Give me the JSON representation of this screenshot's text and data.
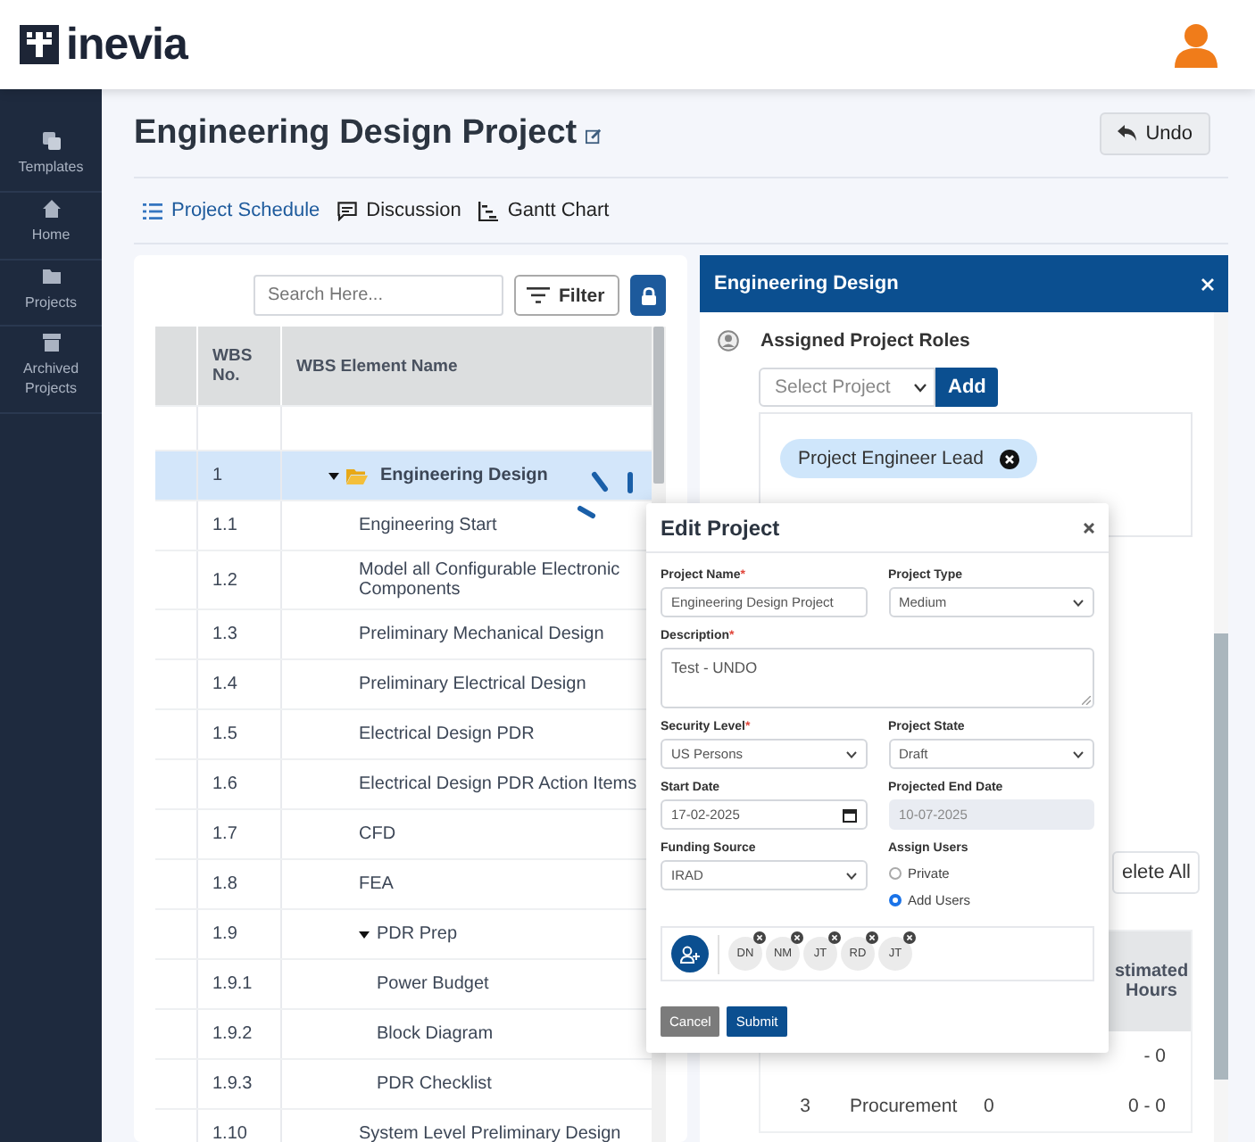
{
  "app": {
    "logo": "inevia"
  },
  "sidebar": {
    "items": [
      {
        "label": "Templates"
      },
      {
        "label": "Home"
      },
      {
        "label": "Projects"
      },
      {
        "label": "Archived Projects"
      }
    ]
  },
  "page": {
    "title": "Engineering Design Project",
    "undo": "Undo"
  },
  "tabs": [
    {
      "label": "Project Schedule",
      "selected": true
    },
    {
      "label": "Discussion",
      "selected": false
    },
    {
      "label": "Gantt Chart",
      "selected": false
    }
  ],
  "schedule": {
    "search_placeholder": "Search Here...",
    "filter": "Filter",
    "columns": [
      "WBS No.",
      "WBS Element Name"
    ],
    "rows": [
      {
        "wbs": "1",
        "name": "Engineering Design",
        "selected": true,
        "expanded": true,
        "children": [
          {
            "wbs": "1.1",
            "name": "Engineering Start",
            "selected": false
          },
          {
            "wbs": "1.2",
            "name": "Model all Configurable Electronic Components",
            "selected": false
          },
          {
            "wbs": "1.3",
            "name": "Preliminary Mechanical Design",
            "selected": false
          },
          {
            "wbs": "1.4",
            "name": "Preliminary Electrical Design",
            "selected": false
          },
          {
            "wbs": "1.5",
            "name": "Electrical Design PDR",
            "selected": false
          },
          {
            "wbs": "1.6",
            "name": "Electrical Design PDR Action Items",
            "selected": false
          },
          {
            "wbs": "1.7",
            "name": "CFD",
            "selected": false
          },
          {
            "wbs": "1.8",
            "name": "FEA",
            "selected": false
          },
          {
            "wbs": "1.9",
            "name": "PDR Prep",
            "selected": false,
            "expanded": true,
            "children": [
              {
                "wbs": "1.9.1",
                "name": "Power Budget",
                "selected": false
              },
              {
                "wbs": "1.9.2",
                "name": "Block Diagram",
                "selected": false
              },
              {
                "wbs": "1.9.3",
                "name": "PDR Checklist",
                "selected": false
              }
            ]
          },
          {
            "wbs": "1.10",
            "name": "System Level Preliminary Design",
            "selected": false
          }
        ]
      }
    ]
  },
  "panel": {
    "title": "Engineering Design",
    "roles_heading": "Assigned Project Roles",
    "select_placeholder": "Select Project",
    "add": "Add",
    "roles": [
      "Project Engineer Lead"
    ],
    "delete_all": "elete All",
    "table": {
      "header": "stimated Hours",
      "rows": [
        {
          "hours": "- 0"
        },
        {
          "index": "3",
          "name": "Procurement",
          "count": "0",
          "hours": "0 - 0"
        }
      ]
    }
  },
  "modal": {
    "title": "Edit Project",
    "fields": [
      {
        "label": "Project Name",
        "required_mark": "*",
        "kind": "text",
        "disabled": false,
        "value": "Engineering Design Project"
      },
      {
        "label": "Project Type",
        "kind": "select",
        "disabled": false,
        "value": "Medium"
      },
      {
        "label": "Description",
        "required_mark": "*",
        "kind": "textarea",
        "disabled": false,
        "value": "Test - UNDO"
      },
      {
        "label": "Security Level",
        "required_mark": "*",
        "kind": "select",
        "disabled": false,
        "value": "US Persons"
      },
      {
        "label": "Project State",
        "kind": "select",
        "disabled": false,
        "value": "Draft"
      },
      {
        "label": "Start Date",
        "kind": "date",
        "disabled": false,
        "value": "17-02-2025"
      },
      {
        "label": "Projected End Date",
        "kind": "text",
        "disabled": true,
        "value": "10-07-2025"
      },
      {
        "label": "Funding Source",
        "kind": "select",
        "disabled": false,
        "value": "IRAD"
      },
      {
        "label": "Assign Users",
        "kind": "radio",
        "options": [
          {
            "label": "Private",
            "selected": false
          },
          {
            "label": "Add Users",
            "selected": true
          }
        ]
      }
    ],
    "users": [
      "DN",
      "NM",
      "JT",
      "RD",
      "JT"
    ],
    "cancel": "Cancel",
    "submit": "Submit"
  }
}
